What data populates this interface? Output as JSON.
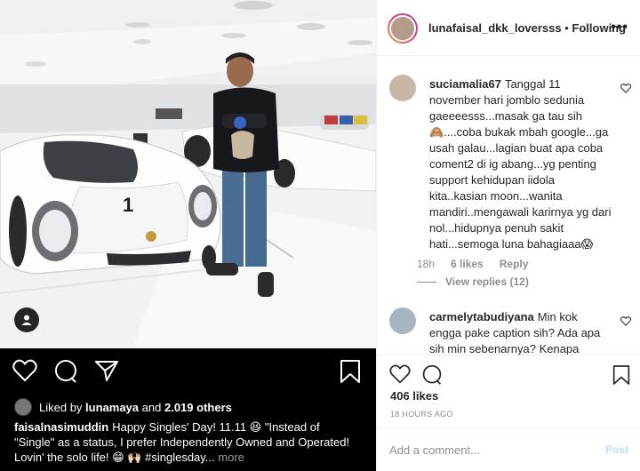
{
  "post": {
    "owner": "lunafaisal_dkk_loversss",
    "separator": "•",
    "follow_status": "Following",
    "more_label": "•••",
    "likes_count": "406 likes",
    "timestamp": "18 HOURS AGO",
    "add_comment_placeholder": "Add a comment...",
    "post_button": "Post"
  },
  "media_panel": {
    "liked_by_prefix": "Liked by",
    "liked_by_user": "lunamaya",
    "liked_by_mid": "and",
    "liked_by_count": "2.019 others",
    "caption_user": "faisalnasimuddin",
    "caption_text": "Happy Singles' Day! 11.11 😆 \"Instead of \"Single\" as a status, I prefer Independently Owned and Operated! Lovin' the solo life! 😁 🙌🏻 #singlesday...",
    "caption_more": "more",
    "car_number": "1"
  },
  "comments": [
    {
      "user": "suciamalia67",
      "text": "Tanggal 11 november hari jomblo sedunia gaeeeesss...masak ga tau sih 🙈....coba bukak mbah google...ga usah galau...lagian buat apa coba coment2 di ig abang...yg penting support kehidupan iidola kita..kasian moon...wanita mandiri..mengawali karirnya yg dari nol...hidupnya penuh sakit hati...semoga luna bahagiaaa😱",
      "time": "18h",
      "likes": "6 likes",
      "reply": "Reply",
      "view_replies": "View replies (12)"
    },
    {
      "user": "carmelytabudiyana",
      "text": "Min kok engga pake caption sih? Ada apa sih min sebenarnya? Kenapa"
    }
  ],
  "colors": {
    "dark_panel": "#000000",
    "accent_post": "#b2dffc",
    "muted": "#8e8e8e"
  },
  "icons": {
    "like": "heart-icon",
    "comment": "comment-bubble-icon",
    "share": "paper-plane-icon",
    "save": "bookmark-icon",
    "user_tags": "user-silhouette-icon"
  }
}
